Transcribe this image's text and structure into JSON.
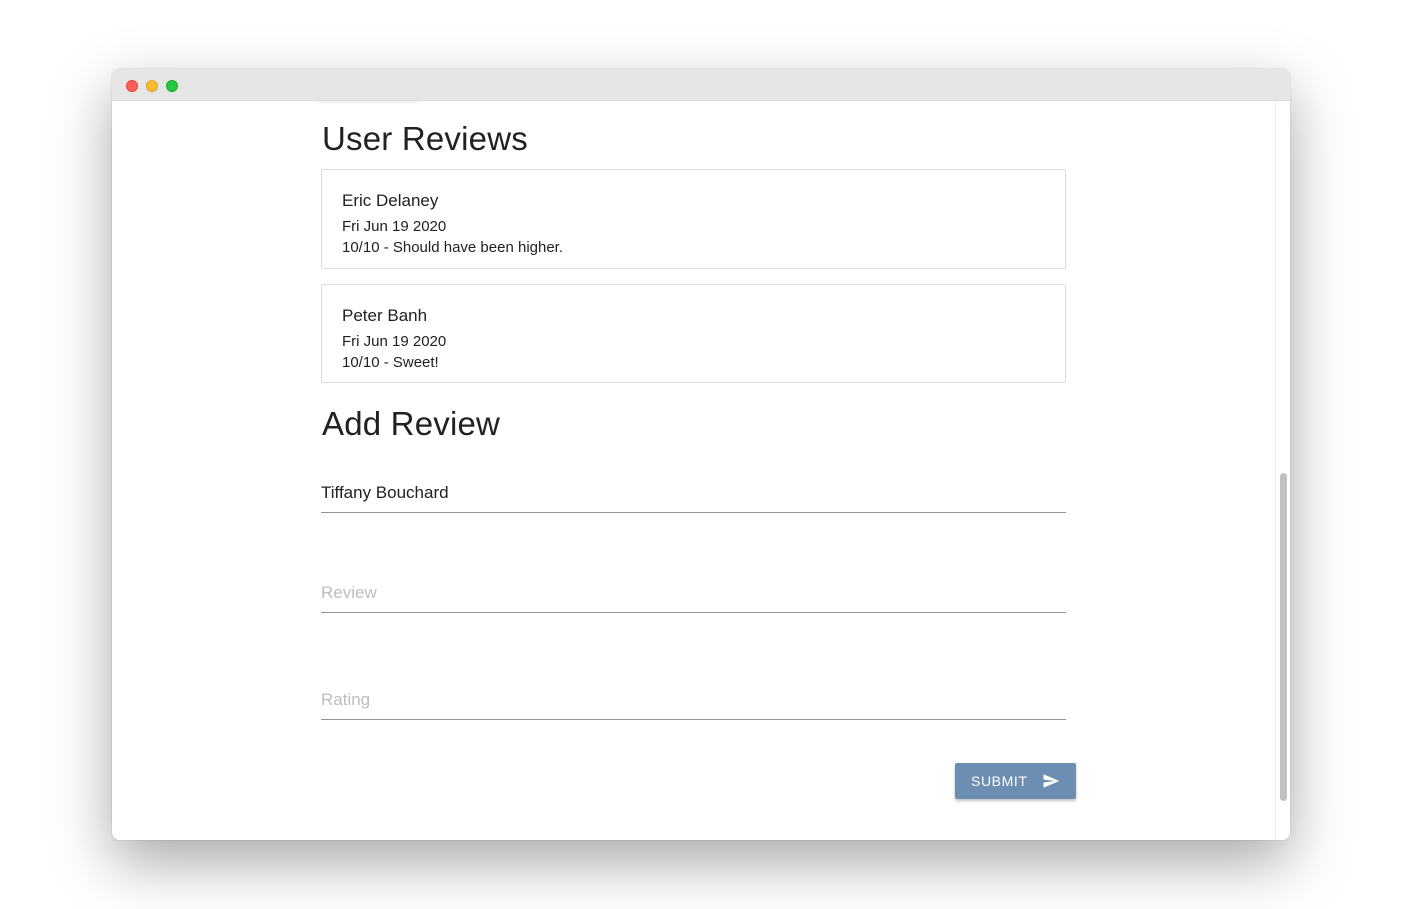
{
  "user_reviews": {
    "title": "User Reviews",
    "items": [
      {
        "name": "Eric Delaney",
        "date": "Fri Jun 19 2020",
        "text": "10/10 - Should have been higher."
      },
      {
        "name": "Peter Banh",
        "date": "Fri Jun 19 2020",
        "text": "10/10 - Sweet!"
      }
    ]
  },
  "add_review": {
    "title": "Add Review",
    "name_value": "Tiffany Bouchard",
    "review_placeholder": "Review",
    "rating_placeholder": "Rating",
    "submit_label": "SUBMIT"
  },
  "icons": {
    "submit": "send-icon"
  },
  "colors": {
    "submit_button": "#6c8eb3",
    "close": "#fe5f57",
    "minimize": "#febc2e",
    "zoom": "#28c840"
  }
}
